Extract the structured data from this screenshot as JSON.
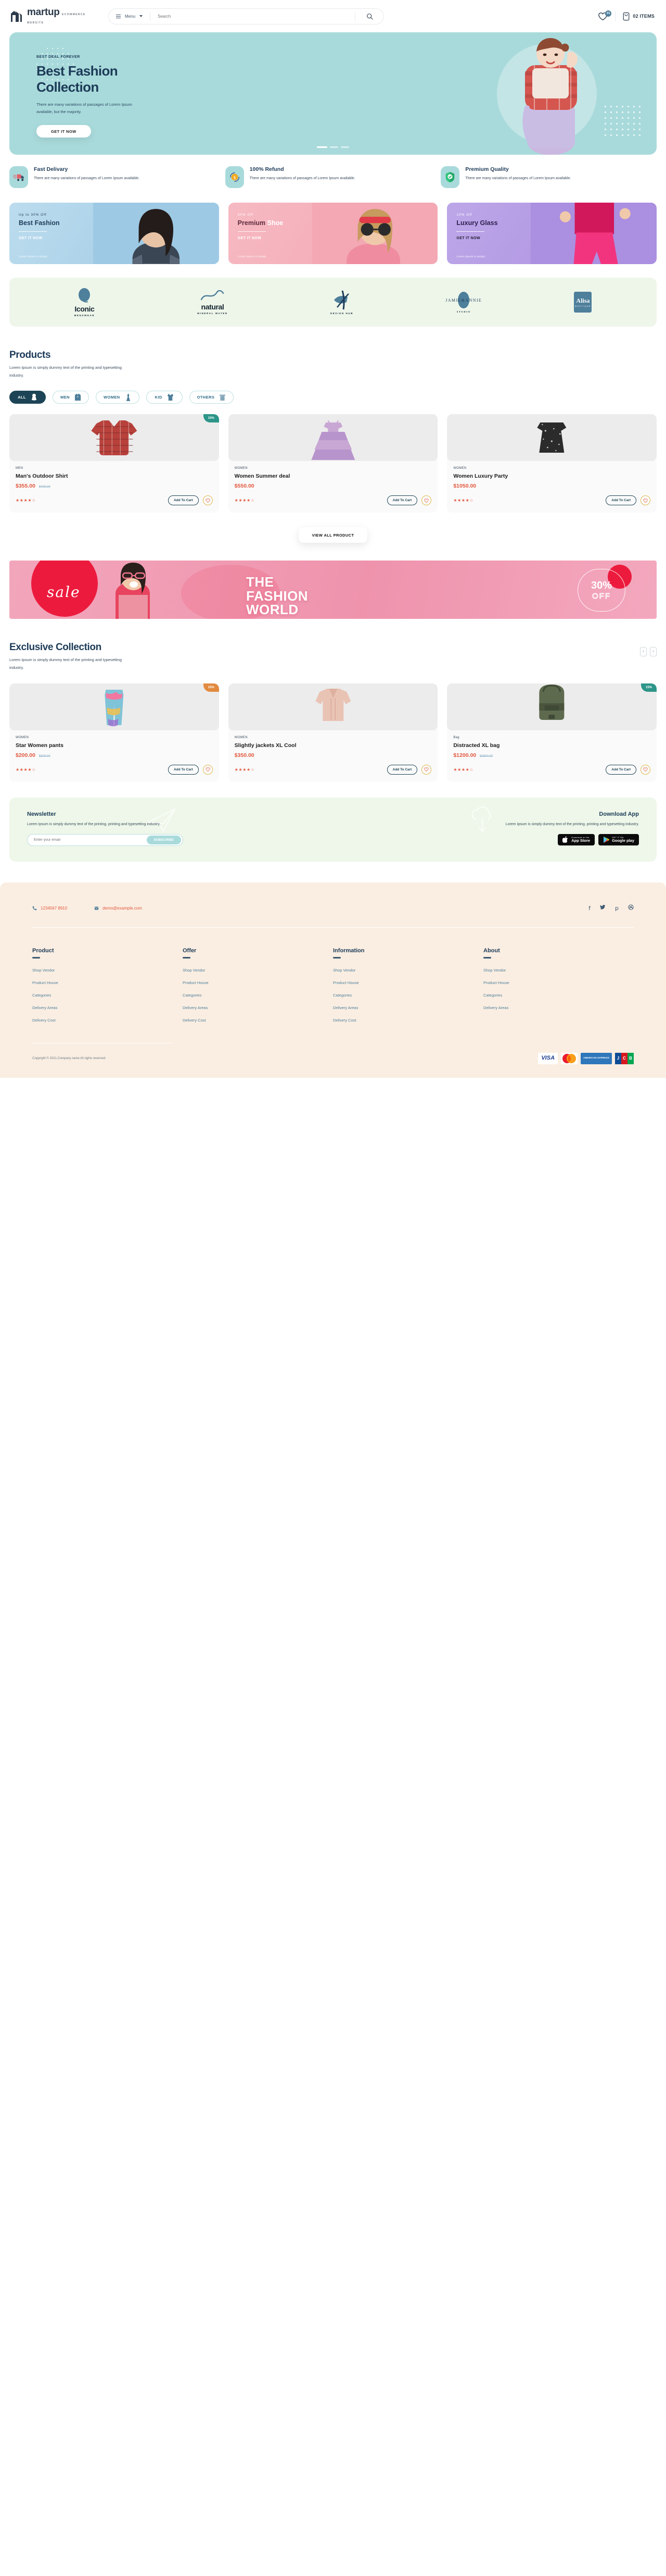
{
  "header": {
    "brand_name": "martup",
    "brand_tagline": "ECOMMERCE WEBSITE",
    "menu_label": "Menu",
    "search_placeholder": "Search",
    "search_value": "",
    "wishlist_count": "01",
    "cart_items": "02 ITEMS"
  },
  "hero": {
    "kicker": "BEST DEAL FOREVER",
    "title_line1": "Best Fashion",
    "title_line2": "Collection",
    "description": "There are many variations of passages of Lorem Ipsum available, but the majority.",
    "cta": "GET IT NOW"
  },
  "features": [
    {
      "title": "Fast Delivary",
      "desc": "There are many variations of passages of Lorem Ipsum available.",
      "icon": "delivery-truck-icon"
    },
    {
      "title": "100% Refund",
      "desc": "There are many variations of passages of Lorem Ipsum available.",
      "icon": "refund-coin-icon"
    },
    {
      "title": "Premium Quality",
      "desc": "There are many variations of passages of Lorem Ipsum available.",
      "icon": "shield-check-icon"
    }
  ],
  "promos": [
    {
      "off": "Up to 30% Off",
      "title": "Best Fashion",
      "title_accent": "",
      "cta": "GET IT NOW",
      "note": "Lorem Ipsum is simply."
    },
    {
      "off": "30% Off",
      "title": "Premium ",
      "title_accent": "Shoe",
      "cta": "GET IT NOW",
      "note": "Lorem Ipsum is simply."
    },
    {
      "off": "10% Off",
      "title": "Luxury Glass",
      "title_accent": "",
      "cta": "GET IT NOW",
      "note": "Lorem Ipsum is simply."
    }
  ],
  "brands": [
    {
      "name": "Iconic",
      "sub": "MENSWEAR"
    },
    {
      "name": "natural",
      "sub": "MINERAL WATER"
    },
    {
      "name": "",
      "sub": "DESIGN HUB"
    },
    {
      "name": "JAMIE&ANNIE",
      "sub": "STUDIO"
    },
    {
      "name": "Alisa",
      "sub": "BOUTIQUE"
    }
  ],
  "products_section": {
    "title": "Products",
    "subtitle": "Lorem Ipsum is simply dummy text of the printing and typesetting industry.",
    "tabs": [
      {
        "label": "ALL",
        "icon": "dress-icon",
        "active": true
      },
      {
        "label": "MEN",
        "icon": "shirt-icon",
        "active": false
      },
      {
        "label": "WOMEN",
        "icon": "dress-icon",
        "active": false
      },
      {
        "label": "KID",
        "icon": "kid-dress-icon",
        "active": false
      },
      {
        "label": "OTHERS",
        "icon": "hanger-rack-icon",
        "active": false
      }
    ],
    "view_all": "VIEW ALL PRODUCT",
    "items": [
      {
        "category": "MEN",
        "name": "Man's Outdoor Shirt",
        "price": "$355.00",
        "old_price": "$400.00",
        "badge": "15%",
        "rating": 4.5,
        "add_to_cart": "Add To Cart"
      },
      {
        "category": "WOMEN",
        "name": "Women Summer deal",
        "price": "$550.00",
        "old_price": "",
        "badge": "",
        "rating": 4.5,
        "add_to_cart": "Add To Cart"
      },
      {
        "category": "WOMEN",
        "name": "Women Luxury Party",
        "price": "$1050.00",
        "old_price": "",
        "badge": "",
        "rating": 4.5,
        "add_to_cart": "Add To Cart"
      }
    ]
  },
  "sale_banner": {
    "script": "sale",
    "line1": "THE",
    "line2": "FASHION",
    "line3": "WORLD",
    "percent": "30%",
    "off": "OFF"
  },
  "exclusive_section": {
    "title": "Exclusive Collection",
    "subtitle": "Lorem Ipsum is simply dummy text of the printing and typesetting industry.",
    "prev": "‹",
    "next": "›",
    "items": [
      {
        "category": "WOMEN",
        "name": "Star Women pants",
        "price": "$200.00",
        "old_price": "$300.00",
        "badge": "10%",
        "rating": 4.5,
        "add_to_cart": "Add To Cart"
      },
      {
        "category": "WOMEN",
        "name": "Slightly jackets XL Cool",
        "price": "$350.00",
        "old_price": "",
        "badge": "",
        "rating": 4.5,
        "add_to_cart": "Add To Cart"
      },
      {
        "category": "Bag",
        "name": "Distracted XL bag",
        "price": "$1200.00",
        "old_price": "$1500.00",
        "badge": "15%",
        "rating": 4.5,
        "add_to_cart": "Add To Cart"
      }
    ]
  },
  "newsletter": {
    "title": "Newsletter",
    "desc": "Lorem Ipsum is simply dummy text of the printing. printing and typesetting industry.",
    "email_placeholder": "Enter your email",
    "email_value": "",
    "subscribe": "SUBSCRIBE",
    "app_title": "Download App",
    "app_desc": "Lorem Ipsum is simply dummy text of the printing. printing and typesetting industry.",
    "store_apple_small": "Download on the",
    "store_apple_big": "App Store",
    "store_google_small": "GET IT ON",
    "store_google_big": "Google play"
  },
  "footer": {
    "phone": "1234567 8910",
    "email": "demo@example.com",
    "social": [
      "f",
      "t",
      "p",
      "d"
    ],
    "columns": [
      {
        "title": "Product",
        "links": [
          "Shop Vendor",
          "Product House",
          "Categories",
          "Delivery Areas",
          "Delivery Cost"
        ]
      },
      {
        "title": "Offer",
        "links": [
          "Shop Vendor",
          "Product House",
          "Categories",
          "Delivery Areas",
          "Delivery Cost"
        ]
      },
      {
        "title": "Information",
        "links": [
          "Shop Vendor",
          "Product House",
          "Categories",
          "Delivery Areas",
          "Delivery Cost"
        ]
      },
      {
        "title": "About",
        "links": [
          "Shop Vendor",
          "Product House",
          "Categories",
          "Delivery Areas"
        ]
      }
    ],
    "copyright": "Copyright © 2021.Company name All rights reserved.",
    "payments": [
      "VISA",
      "MasterCard",
      "AMERICAN EXPRESS",
      "JCB"
    ]
  },
  "colors": {
    "accent_teal": "#a9dadb",
    "navy": "#1d3b58",
    "price_orange": "#e2583f",
    "badge_green": "#2d9589",
    "footer_cream": "#faeee2"
  }
}
